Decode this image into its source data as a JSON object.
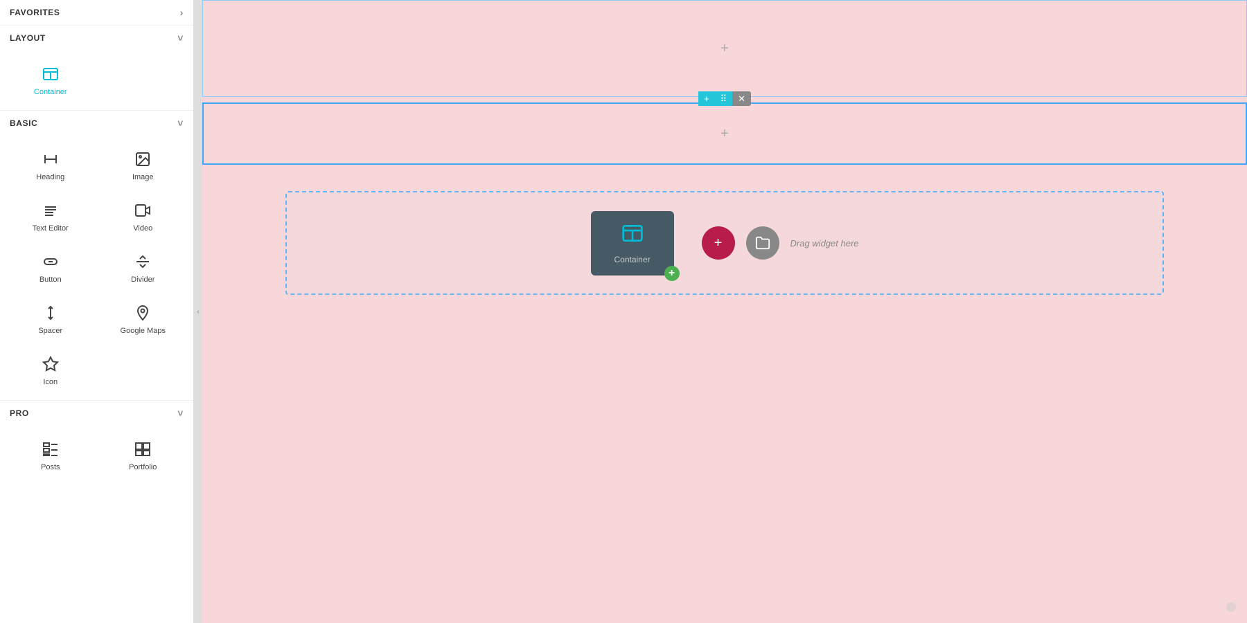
{
  "sidebar": {
    "sections": [
      {
        "id": "favorites",
        "label": "FAVORITES",
        "collapsed": false,
        "chevron": "›",
        "widgets": []
      },
      {
        "id": "layout",
        "label": "LAYOUT",
        "collapsed": false,
        "chevron": "˅",
        "widgets": [
          {
            "id": "container",
            "label": "Container",
            "icon": "container"
          }
        ]
      },
      {
        "id": "basic",
        "label": "BASIC",
        "collapsed": false,
        "chevron": "˅",
        "widgets": [
          {
            "id": "heading",
            "label": "Heading",
            "icon": "heading"
          },
          {
            "id": "image",
            "label": "Image",
            "icon": "image"
          },
          {
            "id": "text-editor",
            "label": "Text Editor",
            "icon": "text-editor"
          },
          {
            "id": "video",
            "label": "Video",
            "icon": "video"
          },
          {
            "id": "button",
            "label": "Button",
            "icon": "button"
          },
          {
            "id": "divider",
            "label": "Divider",
            "icon": "divider"
          },
          {
            "id": "spacer",
            "label": "Spacer",
            "icon": "spacer"
          },
          {
            "id": "google-maps",
            "label": "Google Maps",
            "icon": "google-maps"
          },
          {
            "id": "icon",
            "label": "Icon",
            "icon": "icon"
          }
        ]
      },
      {
        "id": "pro",
        "label": "PRO",
        "collapsed": false,
        "chevron": "˅",
        "widgets": [
          {
            "id": "posts",
            "label": "Posts",
            "icon": "posts"
          },
          {
            "id": "portfolio",
            "label": "Portfolio",
            "icon": "portfolio"
          }
        ]
      }
    ]
  },
  "canvas": {
    "sections": [
      {
        "id": "section-1",
        "active": false,
        "showPlus": true
      },
      {
        "id": "section-2",
        "active": true,
        "showPlus": true
      },
      {
        "id": "section-3",
        "active": false,
        "showPlus": false
      }
    ],
    "toolbar": {
      "add_label": "+",
      "drag_label": "⠿",
      "close_label": "✕"
    },
    "dropZone": {
      "dragLabel": "Drag widget here",
      "ghost_widget_label": "Container"
    }
  }
}
